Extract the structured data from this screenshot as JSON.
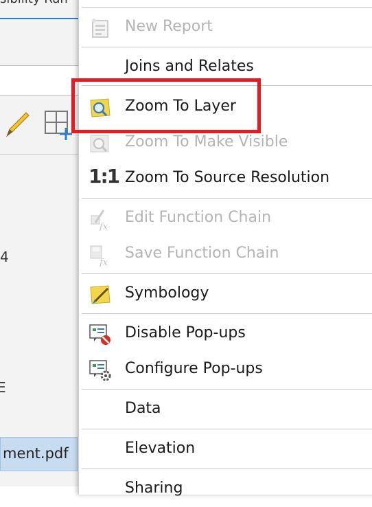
{
  "background": {
    "partial_title": "sibility Ran",
    "partial_number": "4",
    "partial_letter": "E",
    "file_label": "ment.pdf"
  },
  "menu": {
    "items": [
      {
        "label": "New Report",
        "enabled": false,
        "icon": "report-icon"
      },
      {
        "label": "Joins and Relates",
        "enabled": true,
        "icon": ""
      },
      {
        "label": "Zoom To Layer",
        "enabled": true,
        "icon": "zoom-layer-icon",
        "highlighted": true
      },
      {
        "label": "Zoom To Make Visible",
        "enabled": false,
        "icon": "zoom-visible-icon"
      },
      {
        "label": "Zoom To Source Resolution",
        "enabled": true,
        "icon": "one-to-one-icon",
        "icon_text": "1:1"
      },
      {
        "label": "Edit Function Chain",
        "enabled": false,
        "icon": "edit-function-icon"
      },
      {
        "label": "Save Function Chain",
        "enabled": false,
        "icon": "save-function-icon"
      },
      {
        "label": "Symbology",
        "enabled": true,
        "icon": "symbology-icon"
      },
      {
        "label": "Disable Pop-ups",
        "enabled": true,
        "icon": "disable-popups-icon"
      },
      {
        "label": "Configure Pop-ups",
        "enabled": true,
        "icon": "configure-popups-icon"
      },
      {
        "label": "Data",
        "enabled": true,
        "icon": ""
      },
      {
        "label": "Elevation",
        "enabled": true,
        "icon": ""
      },
      {
        "label": "Sharing",
        "enabled": true,
        "icon": ""
      }
    ]
  },
  "colors": {
    "highlight_border": "#e31b23",
    "disabled_text": "#b4b4b4",
    "selected_file_bg": "#c7dcf0"
  }
}
